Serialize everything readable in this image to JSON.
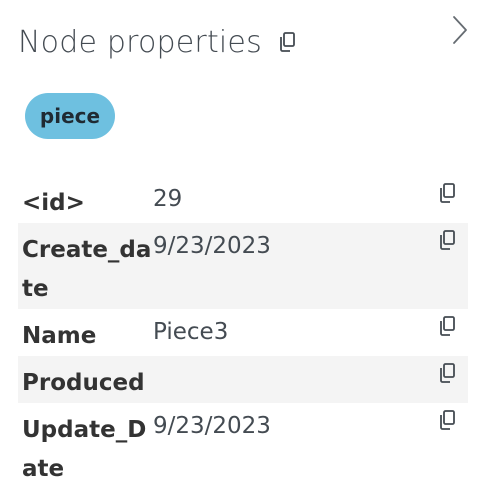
{
  "panel": {
    "title": "Node properties",
    "title_copy_icon": "copy-icon",
    "collapse_icon": "chevron-right-icon"
  },
  "label_tag": {
    "text": "piece",
    "color": "#6ec0e0"
  },
  "properties": [
    {
      "key": "<id>",
      "value": "29",
      "icon": "copy-icon"
    },
    {
      "key": "Create_date",
      "value": "9/23/2023",
      "icon": "copy-icon"
    },
    {
      "key": "Name",
      "value": "Piece3",
      "icon": "copy-icon"
    },
    {
      "key": "Produced",
      "value": "",
      "icon": "copy-icon"
    },
    {
      "key": "Update_Date",
      "value": "9/23/2023",
      "icon": "copy-icon"
    }
  ]
}
